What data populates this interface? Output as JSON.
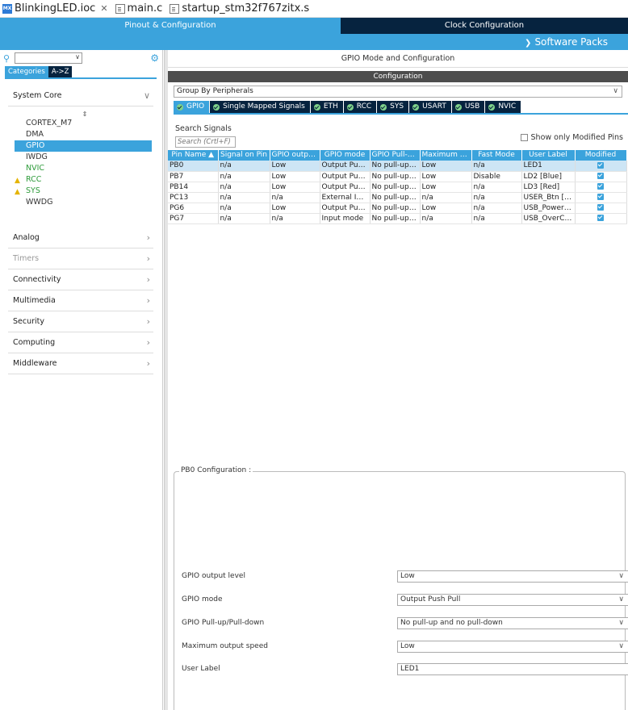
{
  "editor_tabs": [
    {
      "label": "BlinkingLED.ioc",
      "icon": "mx-icon",
      "close": "✕"
    },
    {
      "label": "main.c",
      "icon": "c-file-icon"
    },
    {
      "label": "startup_stm32f767zitx.s",
      "icon": "asm-file-icon"
    }
  ],
  "banner": {
    "pinout_tab": "Pinout & Configuration",
    "clock_tab": "Clock Configuration",
    "software_packs": "Software Packs"
  },
  "left": {
    "search_value": "",
    "category_tabs": [
      "Categories",
      "A->Z"
    ],
    "system_core": {
      "label": "System Core",
      "items": [
        {
          "label": "CORTEX_M7",
          "state": "normal"
        },
        {
          "label": "DMA",
          "state": "normal"
        },
        {
          "label": "GPIO",
          "state": "selected"
        },
        {
          "label": "IWDG",
          "state": "normal"
        },
        {
          "label": "NVIC",
          "state": "green"
        },
        {
          "label": "RCC",
          "state": "warning"
        },
        {
          "label": "SYS",
          "state": "warning"
        },
        {
          "label": "WWDG",
          "state": "normal"
        }
      ]
    },
    "sections": [
      {
        "label": "Analog",
        "disabled": false
      },
      {
        "label": "Timers",
        "disabled": true
      },
      {
        "label": "Connectivity",
        "disabled": false
      },
      {
        "label": "Multimedia",
        "disabled": false
      },
      {
        "label": "Security",
        "disabled": false
      },
      {
        "label": "Computing",
        "disabled": false
      },
      {
        "label": "Middleware",
        "disabled": false
      }
    ]
  },
  "right": {
    "title": "GPIO Mode and Configuration",
    "config_label": "Configuration",
    "group_by": "Group By Peripherals",
    "peripheral_tabs": [
      "GPIO",
      "Single Mapped Signals",
      "ETH",
      "RCC",
      "SYS",
      "USART",
      "USB",
      "NVIC"
    ],
    "search_label": "Search Signals",
    "search_placeholder": "Search (Crtl+F)",
    "show_modified_label": "Show only Modified Pins",
    "table": {
      "columns": [
        "Pin Name",
        "Signal on Pin",
        "GPIO output l...",
        "GPIO mode",
        "GPIO Pull-up/...",
        "Maximum out...",
        "Fast Mode",
        "User Label",
        "Modified"
      ],
      "rows": [
        [
          "PB0",
          "n/a",
          "Low",
          "Output Push ...",
          "No pull-up an...",
          "Low",
          "n/a",
          "LED1"
        ],
        [
          "PB7",
          "n/a",
          "Low",
          "Output Push ...",
          "No pull-up an...",
          "Low",
          "Disable",
          "LD2 [Blue]"
        ],
        [
          "PB14",
          "n/a",
          "Low",
          "Output Push ...",
          "No pull-up an...",
          "Low",
          "n/a",
          "LD3 [Red]"
        ],
        [
          "PC13",
          "n/a",
          "n/a",
          "External Inter...",
          "No pull-up an...",
          "n/a",
          "n/a",
          "USER_Btn [B1]"
        ],
        [
          "PG6",
          "n/a",
          "Low",
          "Output Push ...",
          "No pull-up an...",
          "Low",
          "n/a",
          "USB_PowerS..."
        ],
        [
          "PG7",
          "n/a",
          "n/a",
          "Input mode",
          "No pull-up an...",
          "n/a",
          "n/a",
          "USB_OverCur..."
        ]
      ]
    },
    "pb0_config": {
      "title": "PB0 Configuration :",
      "fields": [
        {
          "label": "GPIO output level",
          "value": "Low",
          "type": "select"
        },
        {
          "label": "GPIO mode",
          "value": "Output Push Pull",
          "type": "select"
        },
        {
          "label": "GPIO Pull-up/Pull-down",
          "value": "No pull-up and no pull-down",
          "type": "select"
        },
        {
          "label": "Maximum output speed",
          "value": "Low",
          "type": "select"
        },
        {
          "label": "User Label",
          "value": "LED1",
          "type": "text"
        }
      ]
    }
  },
  "colors": {
    "accent": "#3ba3dc",
    "dark": "#06233f",
    "green": "#2e9b3a",
    "warning": "#e5b400"
  }
}
